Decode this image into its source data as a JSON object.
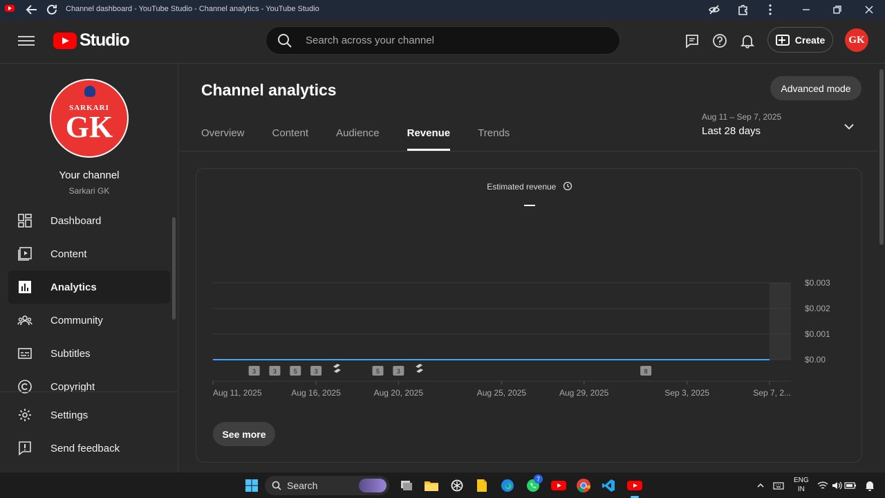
{
  "browser": {
    "title": "Channel dashboard - YouTube Studio - Channel analytics - YouTube Studio"
  },
  "header": {
    "logo_text": "Studio",
    "search_placeholder": "Search across your channel",
    "create_label": "Create",
    "avatar_initials": "GK"
  },
  "sidebar": {
    "avatar_top": "SARKARI",
    "avatar_main": "GK",
    "channel_title": "Your channel",
    "channel_name": "Sarkari GK",
    "items": [
      {
        "label": "Dashboard",
        "icon": "dashboard-icon"
      },
      {
        "label": "Content",
        "icon": "content-icon"
      },
      {
        "label": "Analytics",
        "icon": "analytics-icon",
        "active": true
      },
      {
        "label": "Community",
        "icon": "community-icon"
      },
      {
        "label": "Subtitles",
        "icon": "subtitles-icon"
      },
      {
        "label": "Copyright",
        "icon": "copyright-icon"
      }
    ],
    "bottom_items": [
      {
        "label": "Settings",
        "icon": "gear-icon"
      },
      {
        "label": "Send feedback",
        "icon": "feedback-icon"
      }
    ]
  },
  "main": {
    "title": "Channel analytics",
    "advanced_mode_label": "Advanced mode",
    "tabs": [
      {
        "label": "Overview"
      },
      {
        "label": "Content"
      },
      {
        "label": "Audience"
      },
      {
        "label": "Revenue",
        "active": true
      },
      {
        "label": "Trends"
      }
    ],
    "date_range": {
      "range": "Aug 11 – Sep 7, 2025",
      "label": "Last 28 days"
    },
    "see_more_label": "See more"
  },
  "chart_data": {
    "type": "line",
    "title": "Estimated revenue",
    "value_display": "—",
    "x_ticks": [
      "Aug 11, 2025",
      "Aug 16, 2025",
      "Aug 20, 2025",
      "Aug 25, 2025",
      "Aug 29, 2025",
      "Sep 3, 2025",
      "Sep 7, 2..."
    ],
    "y_ticks": [
      "$0.003",
      "$0.002",
      "$0.001",
      "$0.00"
    ],
    "ylim": [
      0,
      0.003
    ],
    "series": [
      {
        "values": [
          0,
          0,
          0,
          0,
          0,
          0,
          0,
          0,
          0,
          0,
          0,
          0,
          0,
          0,
          0,
          0,
          0,
          0,
          0,
          0,
          0,
          0,
          0,
          0,
          0,
          0,
          0,
          0
        ]
      }
    ],
    "line_color": "#3ea6ff",
    "upload_markers": [
      {
        "label": "3",
        "day": 2
      },
      {
        "label": "3",
        "day": 3
      },
      {
        "label": "5",
        "day": 4
      },
      {
        "label": "3",
        "day": 5
      },
      {
        "label": "shorts",
        "day": 6
      },
      {
        "label": "5",
        "day": 8
      },
      {
        "label": "3",
        "day": 9
      },
      {
        "label": "shorts",
        "day": 10
      },
      {
        "label": "8",
        "day": 21
      }
    ]
  },
  "taskbar": {
    "search_label": "Search",
    "lang_top": "ENG",
    "lang_bottom": "IN",
    "whatsapp_badge": "7"
  }
}
